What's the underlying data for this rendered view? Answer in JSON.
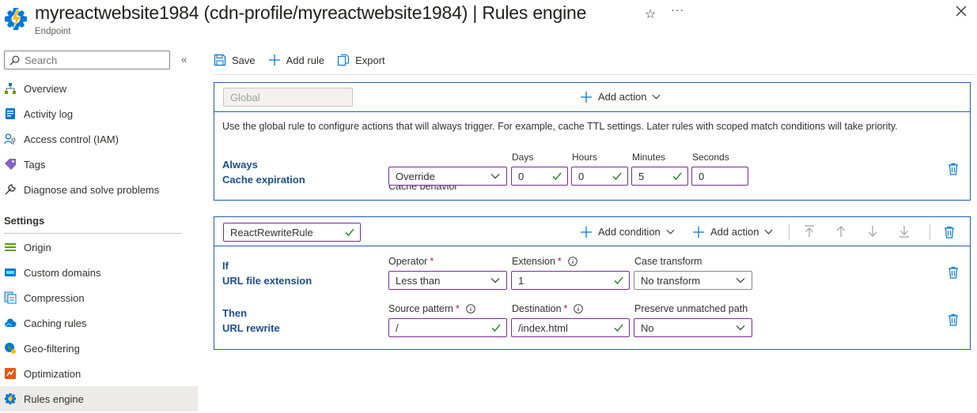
{
  "header": {
    "title": "myreactwebsite1984 (cdn-profile/myreactwebsite1984) | Rules engine",
    "subtitle": "Endpoint"
  },
  "sidebar": {
    "search_placeholder": "Search",
    "items_top": [
      {
        "label": "Overview",
        "icon": "overview-icon"
      },
      {
        "label": "Activity log",
        "icon": "activity-log-icon"
      },
      {
        "label": "Access control (IAM)",
        "icon": "iam-icon"
      },
      {
        "label": "Tags",
        "icon": "tag-icon"
      },
      {
        "label": "Diagnose and solve problems",
        "icon": "wrench-icon"
      }
    ],
    "settings_heading": "Settings",
    "items_settings": [
      {
        "label": "Origin",
        "icon": "origin-icon"
      },
      {
        "label": "Custom domains",
        "icon": "custom-domains-icon"
      },
      {
        "label": "Compression",
        "icon": "compression-icon"
      },
      {
        "label": "Caching rules",
        "icon": "cloud-icon"
      },
      {
        "label": "Geo-filtering",
        "icon": "globe-icon"
      },
      {
        "label": "Optimization",
        "icon": "optimization-icon"
      },
      {
        "label": "Rules engine",
        "icon": "gear-icon",
        "active": true
      }
    ]
  },
  "toolbar": {
    "save_label": "Save",
    "add_rule_label": "Add rule",
    "export_label": "Export"
  },
  "global_rule": {
    "name": "Global",
    "add_action_label": "Add action",
    "description": "Use the global rule to configure actions that will always trigger. For example, cache TTL settings. Later rules with scoped match conditions will take priority.",
    "condition_title": "Always",
    "action_title": "Cache expiration",
    "cache_behavior_label": "Cache behavior",
    "cache_behavior_value": "Override",
    "days_label": "Days",
    "days_value": "0",
    "hours_label": "Hours",
    "hours_value": "0",
    "minutes_label": "Minutes",
    "minutes_value": "5",
    "seconds_label": "Seconds",
    "seconds_value": "0"
  },
  "rule": {
    "name": "ReactRewriteRule",
    "add_condition_label": "Add condition",
    "add_action_label": "Add action",
    "if_title": "If",
    "condition_title": "URL file extension",
    "operator_label": "Operator",
    "operator_value": "Less than",
    "extension_label": "Extension",
    "extension_value": "1",
    "case_label": "Case transform",
    "case_value": "No transform",
    "then_title": "Then",
    "action_title": "URL rewrite",
    "source_label": "Source pattern",
    "source_value": "/",
    "destination_label": "Destination",
    "destination_value": "/index.html",
    "preserve_label": "Preserve unmatched path",
    "preserve_value": "No"
  },
  "required_marker": "*",
  "colors": {
    "accent": "#0078d4",
    "card_border": "#1f5ea8",
    "field_focus": "#7a2d8f",
    "valid_check": "#107c10",
    "required": "#a4262c"
  }
}
